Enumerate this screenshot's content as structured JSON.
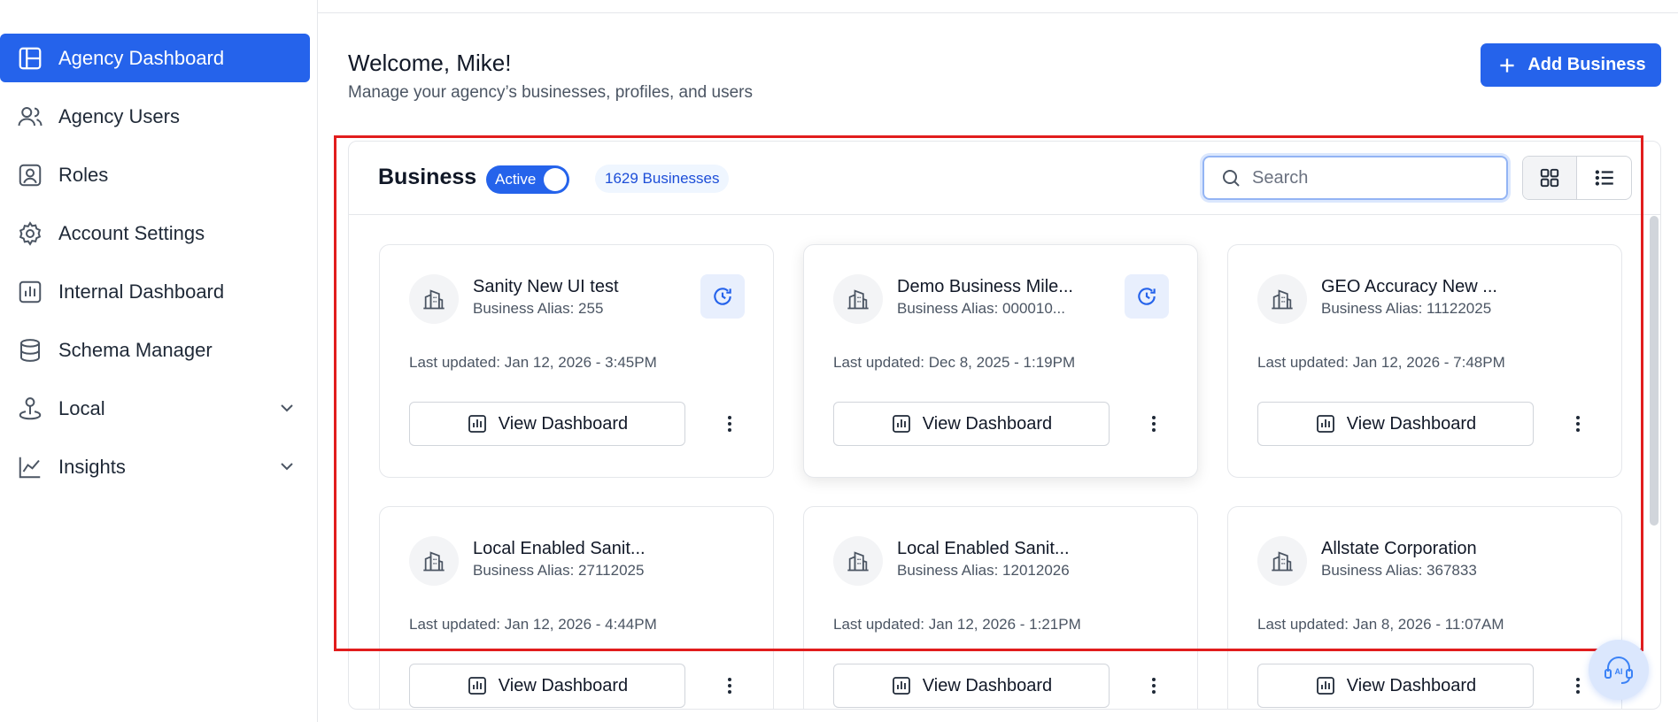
{
  "sidebar": {
    "items": [
      {
        "label": "Agency Dashboard",
        "icon": "layout-icon",
        "active": true
      },
      {
        "label": "Agency Users",
        "icon": "users-icon"
      },
      {
        "label": "Roles",
        "icon": "user-badge-icon"
      },
      {
        "label": "Account Settings",
        "icon": "gear-icon"
      },
      {
        "label": "Internal Dashboard",
        "icon": "bar-chart-icon"
      },
      {
        "label": "Schema Manager",
        "icon": "database-icon"
      },
      {
        "label": "Local",
        "icon": "location-pin-icon",
        "expandable": true
      },
      {
        "label": "Insights",
        "icon": "line-chart-icon",
        "expandable": true
      }
    ]
  },
  "header": {
    "welcome": "Welcome, Mike!",
    "subtitle": "Manage your agency’s businesses, profiles, and users",
    "add_button_label": "Add Business"
  },
  "panel": {
    "title": "Business",
    "toggle_label": "Active",
    "count_badge": "1629 Businesses",
    "search_placeholder": "Search",
    "view_mode": "grid"
  },
  "cards": [
    {
      "name": "Sanity New UI test",
      "alias": "Business Alias: 255",
      "updated": "Last updated: Jan 12, 2026 - 3:45PM",
      "button": "View Dashboard",
      "sync": true
    },
    {
      "name": "Demo Business Mile...",
      "alias": "Business Alias: 000010...",
      "updated": "Last updated: Dec 8, 2025 - 1:19PM",
      "button": "View Dashboard",
      "sync": true
    },
    {
      "name": "GEO Accuracy New ...",
      "alias": "Business Alias: 11122025",
      "updated": "Last updated: Jan 12, 2026 - 7:48PM",
      "button": "View Dashboard",
      "sync": false
    },
    {
      "name": "Local Enabled Sanit...",
      "alias": "Business Alias: 27112025",
      "updated": "Last updated: Jan 12, 2026 - 4:44PM",
      "button": "View Dashboard",
      "sync": false
    },
    {
      "name": "Local Enabled Sanit...",
      "alias": "Business Alias: 12012026",
      "updated": "Last updated: Jan 12, 2026 - 1:21PM",
      "button": "View Dashboard",
      "sync": false
    },
    {
      "name": "Allstate Corporation",
      "alias": "Business Alias: 367833",
      "updated": "Last updated: Jan 8, 2026 - 11:07AM",
      "button": "View Dashboard",
      "sync": false
    }
  ],
  "colors": {
    "accent": "#2563eb",
    "highlight_box": "#e11d1d"
  }
}
